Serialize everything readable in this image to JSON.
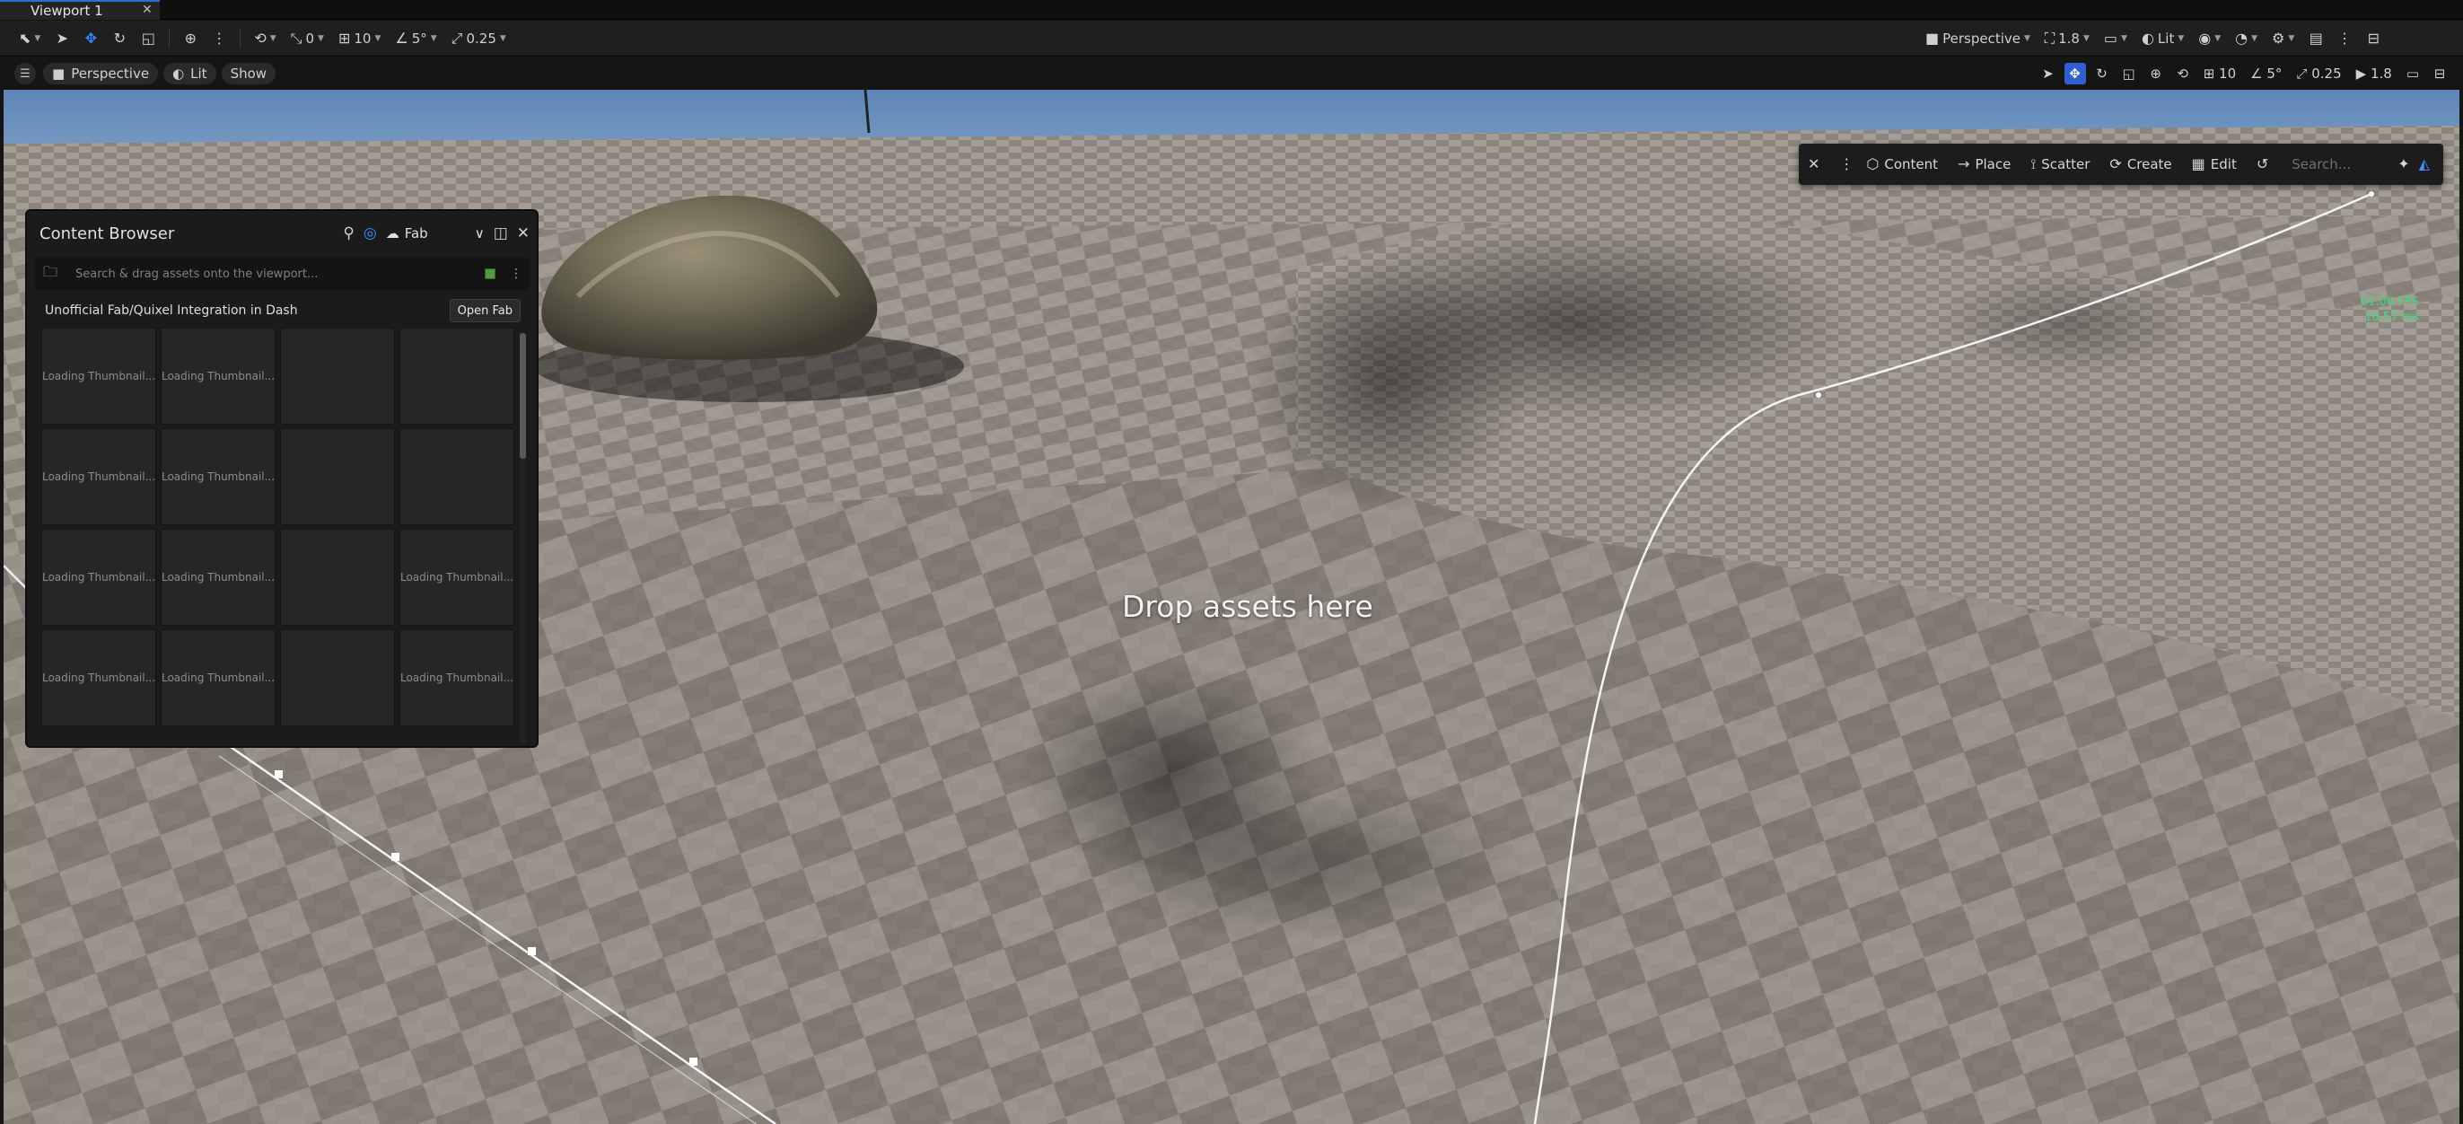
{
  "tab": {
    "title": "Viewport 1",
    "close": "✕"
  },
  "toolbar": {
    "translate_snap": "0",
    "grid_size": "10",
    "rotate_snap": "5°",
    "scale_snap": "0.25",
    "view_mode": "Perspective",
    "camera_speed": "1.8",
    "lighting": "Lit"
  },
  "viewport_bar": {
    "perspective": "Perspective",
    "lit": "Lit",
    "show": "Show",
    "grid_value": "10",
    "angle_value": "5°",
    "scale_value": "0.25",
    "camera_value": "1.8"
  },
  "viewport": {
    "drop_text": "Drop assets here",
    "fps": "61.00 FPS",
    "ms": "16.57 ms"
  },
  "place_bar": {
    "content": "Content",
    "place": "Place",
    "scatter": "Scatter",
    "create": "Create",
    "edit": "Edit",
    "search_placeholder": "Search..."
  },
  "content_browser": {
    "title": "Content Browser",
    "source": "Fab",
    "search_placeholder": "Search & drag assets onto the viewport...",
    "integration_label": "Unofficial Fab/Quixel Integration in Dash",
    "open_fab": "Open Fab",
    "thumbnails": [
      "Loading Thumbnail...",
      "Loading Thumbnail...",
      "",
      "",
      "Loading Thumbnail...",
      "Loading Thumbnail...",
      "",
      "",
      "Loading Thumbnail...",
      "Loading Thumbnail...",
      "",
      "Loading Thumbnail...",
      "Loading Thumbnail...",
      "Loading Thumbnail...",
      "",
      "Loading Thumbnail..."
    ]
  }
}
